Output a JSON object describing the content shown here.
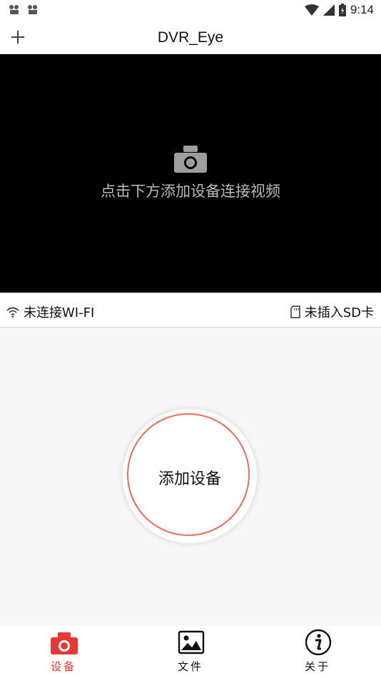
{
  "status_bar": {
    "time": "9:14"
  },
  "app_bar": {
    "title": "DVR_Eye",
    "add_icon": "plus-icon"
  },
  "video": {
    "hint": "点击下方添加设备连接视频",
    "icon": "camera-icon"
  },
  "info_bar": {
    "wifi_status": "未连接WI-FI",
    "sd_status": "未插入SD卡"
  },
  "main": {
    "add_device_label": "添加设备",
    "accent_color": "#ef6b56"
  },
  "tabs": [
    {
      "label": "设备",
      "icon": "camera-icon",
      "active": true,
      "color": "#e53935"
    },
    {
      "label": "文件",
      "icon": "image-icon",
      "active": false,
      "color": "#111111"
    },
    {
      "label": "关于",
      "icon": "info-icon",
      "active": false,
      "color": "#111111"
    }
  ]
}
